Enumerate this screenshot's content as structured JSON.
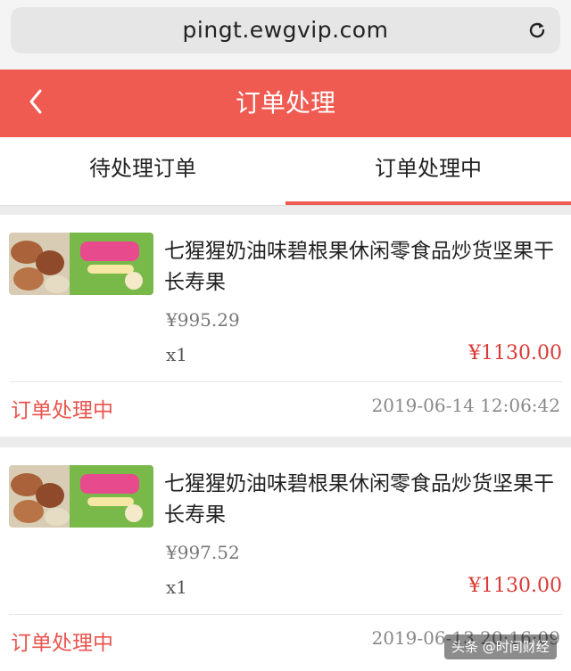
{
  "browser": {
    "url": "pingt.ewgvip.com"
  },
  "header": {
    "title": "订单处理"
  },
  "tabs": [
    {
      "label": "待处理订单",
      "active": false
    },
    {
      "label": "订单处理中",
      "active": true
    }
  ],
  "orders": [
    {
      "product_name": "七猩猩奶油味碧根果休闲零食品炒货坚果干长寿果",
      "price": "¥995.29",
      "quantity": "x1",
      "total": "¥1130.00",
      "status": "订单处理中",
      "time": "2019-06-14 12:06:42"
    },
    {
      "product_name": "七猩猩奶油味碧根果休闲零食品炒货坚果干长寿果",
      "price": "¥997.52",
      "quantity": "x1",
      "total": "¥1130.00",
      "status": "订单处理中",
      "time": "2019-06-13 20:16:09"
    }
  ],
  "watermark": "头条 @时间财经",
  "colors": {
    "accent": "#ef5a51",
    "price_red": "#d93a35",
    "status_red": "#e8554e"
  },
  "icons": {
    "reload": "reload-icon",
    "back": "back-chevron-icon"
  }
}
